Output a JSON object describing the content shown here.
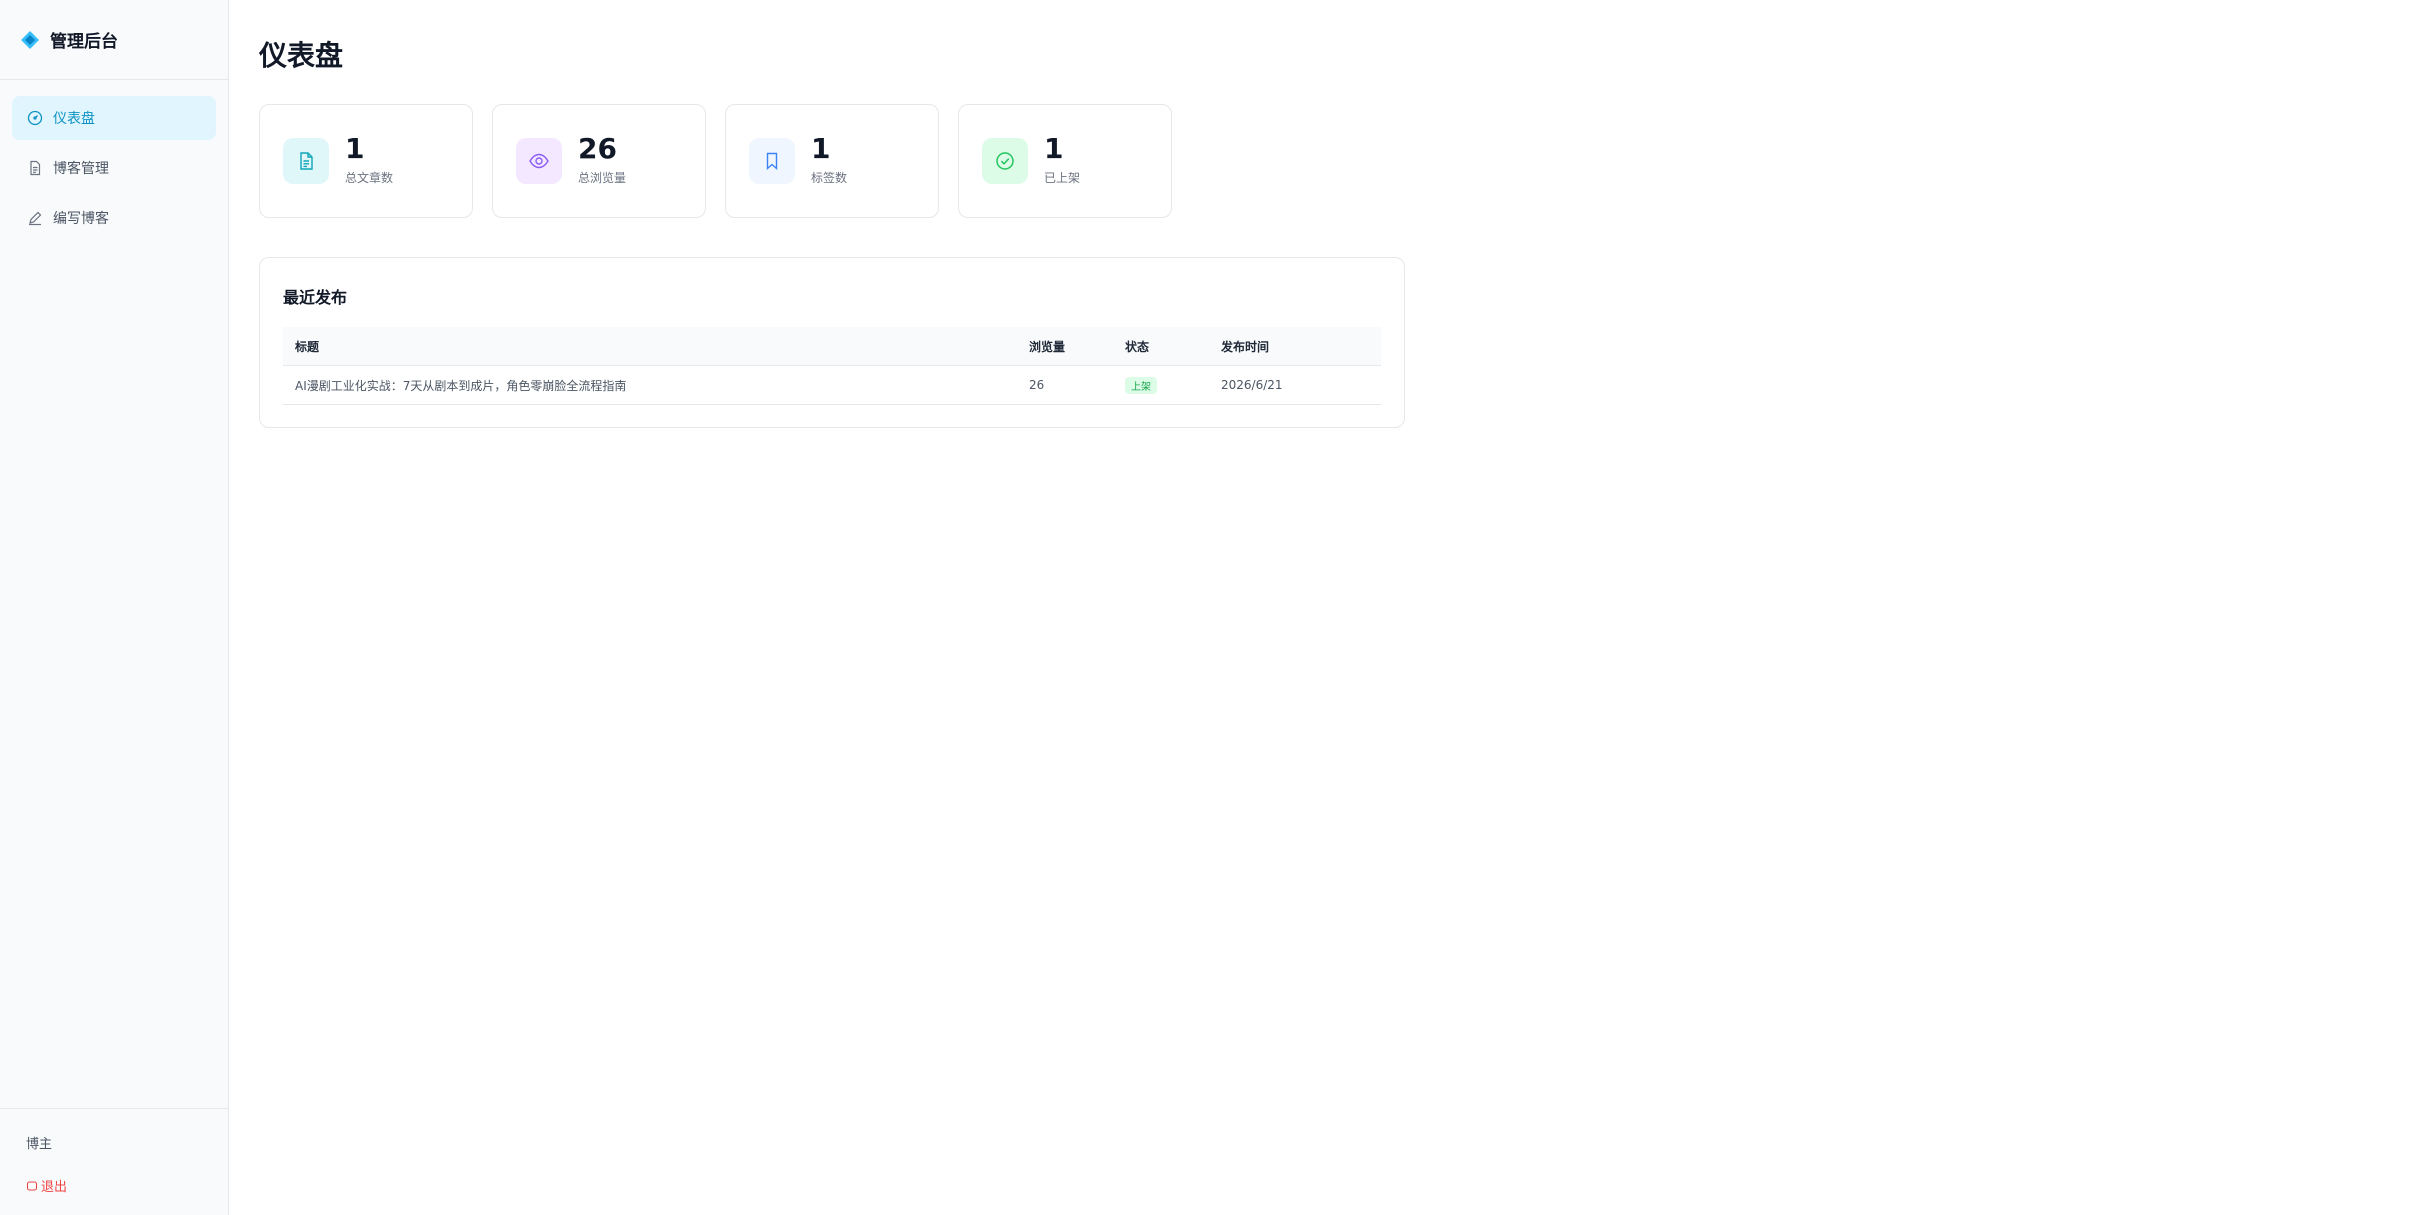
{
  "app": {
    "title": "管理后台"
  },
  "sidebar": {
    "items": [
      {
        "label": "仪表盘",
        "icon": "dashboard-gauge-icon",
        "active": true
      },
      {
        "label": "博客管理",
        "icon": "document-icon",
        "active": false
      },
      {
        "label": "编写博客",
        "icon": "pen-icon",
        "active": false
      }
    ],
    "footer": {
      "user": "博主",
      "logout": "退出"
    }
  },
  "page": {
    "title": "仪表盘"
  },
  "stats": [
    {
      "value": "1",
      "label": "总文章数",
      "icon": "document-icon",
      "bg": "#e0f7fa",
      "color": "#0ea5b7"
    },
    {
      "value": "26",
      "label": "总浏览量",
      "icon": "eye-icon",
      "bg": "#f3e8ff",
      "color": "#8b5cf6"
    },
    {
      "value": "1",
      "label": "标签数",
      "icon": "bookmark-icon",
      "bg": "#eff6ff",
      "color": "#3b82f6"
    },
    {
      "value": "1",
      "label": "已上架",
      "icon": "check-circle-icon",
      "bg": "#dcfce7",
      "color": "#22c55e"
    }
  ],
  "recent": {
    "title": "最近发布",
    "columns": [
      "标题",
      "浏览量",
      "状态",
      "发布时间"
    ],
    "rows": [
      {
        "title": "AI漫剧工业化实战：7天从剧本到成片，角色零崩脸全流程指南",
        "views": "26",
        "status": "上架",
        "date": "2026/6/21"
      }
    ]
  },
  "colors": {
    "accent": "#0e93c4",
    "active_bg": "#e0f5fd",
    "danger": "#ef4444"
  }
}
